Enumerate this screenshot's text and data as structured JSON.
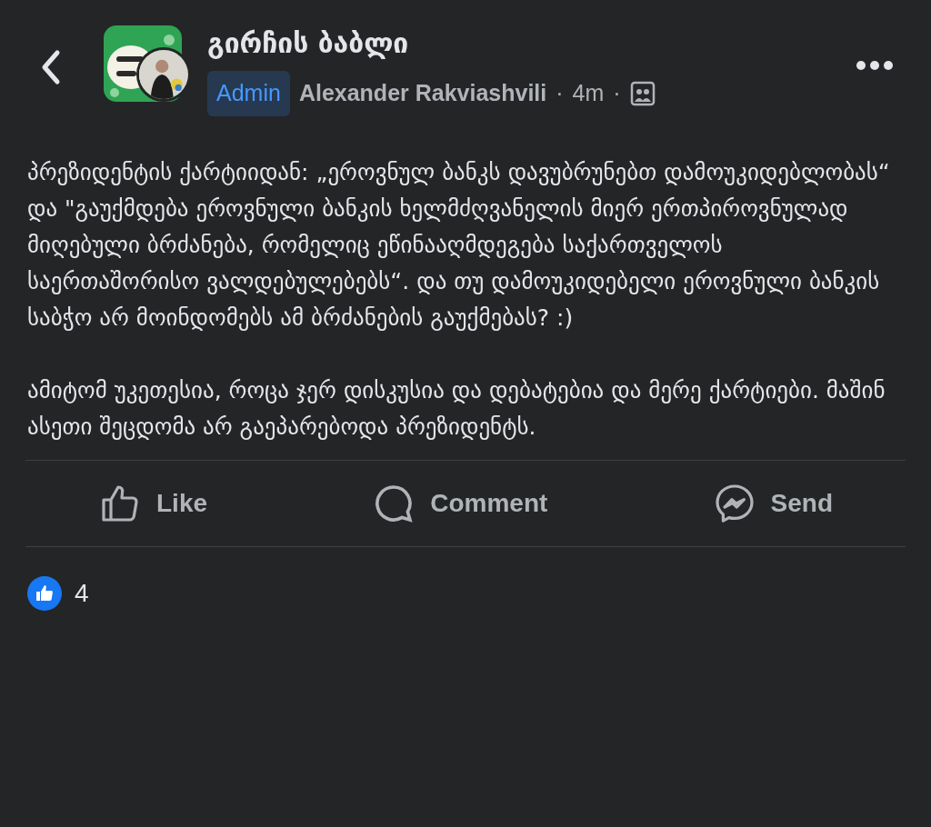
{
  "header": {
    "group_name": "გირჩის ბაბლი",
    "badge": "Admin",
    "author": "Alexander Rakviashvili",
    "separator_1": "·",
    "time": "4m",
    "separator_2": "·"
  },
  "post": {
    "paragraphs": [
      "პრეზიდენტის ქარტიიდან: „ეროვნულ ბანკს დავუბრუნებთ დამოუკიდებლობას“ და \"გაუქმდება ეროვნული ბანკის ხელმძღვანელის მიერ ერთპიროვნულად მიღებული ბრძანება, რომელიც ეწინააღმდეგება საქართველოს საერთაშორისო ვალდებულებებს“. და თუ დამოუკიდებელი ეროვნული ბანკის საბჭო არ მოინდომებს ამ ბრძანების გაუქმებას? :)",
      "ამიტომ უკეთესია, როცა ჯერ დისკუსია და დებატებია და მერე ქარტიები. მაშინ ასეთი შეცდომა არ გაეპარებოდა პრეზიდენტს."
    ]
  },
  "actions": [
    {
      "kind": "like",
      "label": "Like"
    },
    {
      "kind": "comment",
      "label": "Comment"
    },
    {
      "kind": "send",
      "label": "Send"
    }
  ],
  "reactions": {
    "count": "4"
  }
}
